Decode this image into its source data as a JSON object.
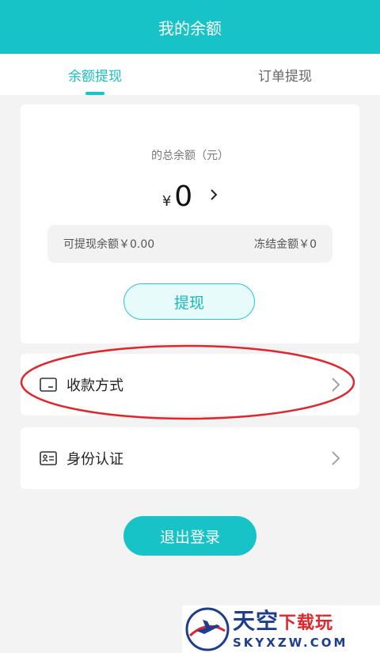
{
  "header": {
    "title": "我的余额"
  },
  "tabs": [
    {
      "label": "余额提现",
      "active": true
    },
    {
      "label": "订单提现",
      "active": false
    }
  ],
  "balance": {
    "total_label": "的总余额（元）",
    "currency": "¥",
    "amount": "0",
    "withdrawable": "可提现余额￥0.00",
    "frozen": "冻结金额￥0"
  },
  "withdraw_button": "提现",
  "rows": {
    "payment_method": "收款方式",
    "identity": "身份认证"
  },
  "logout_button": "退出登录",
  "watermark": {
    "main": "天空",
    "main_red": "下载玩",
    "sub": "SKYXZW.COM"
  },
  "colors": {
    "accent": "#17c3c6",
    "highlight_ring": "#e0262c"
  }
}
